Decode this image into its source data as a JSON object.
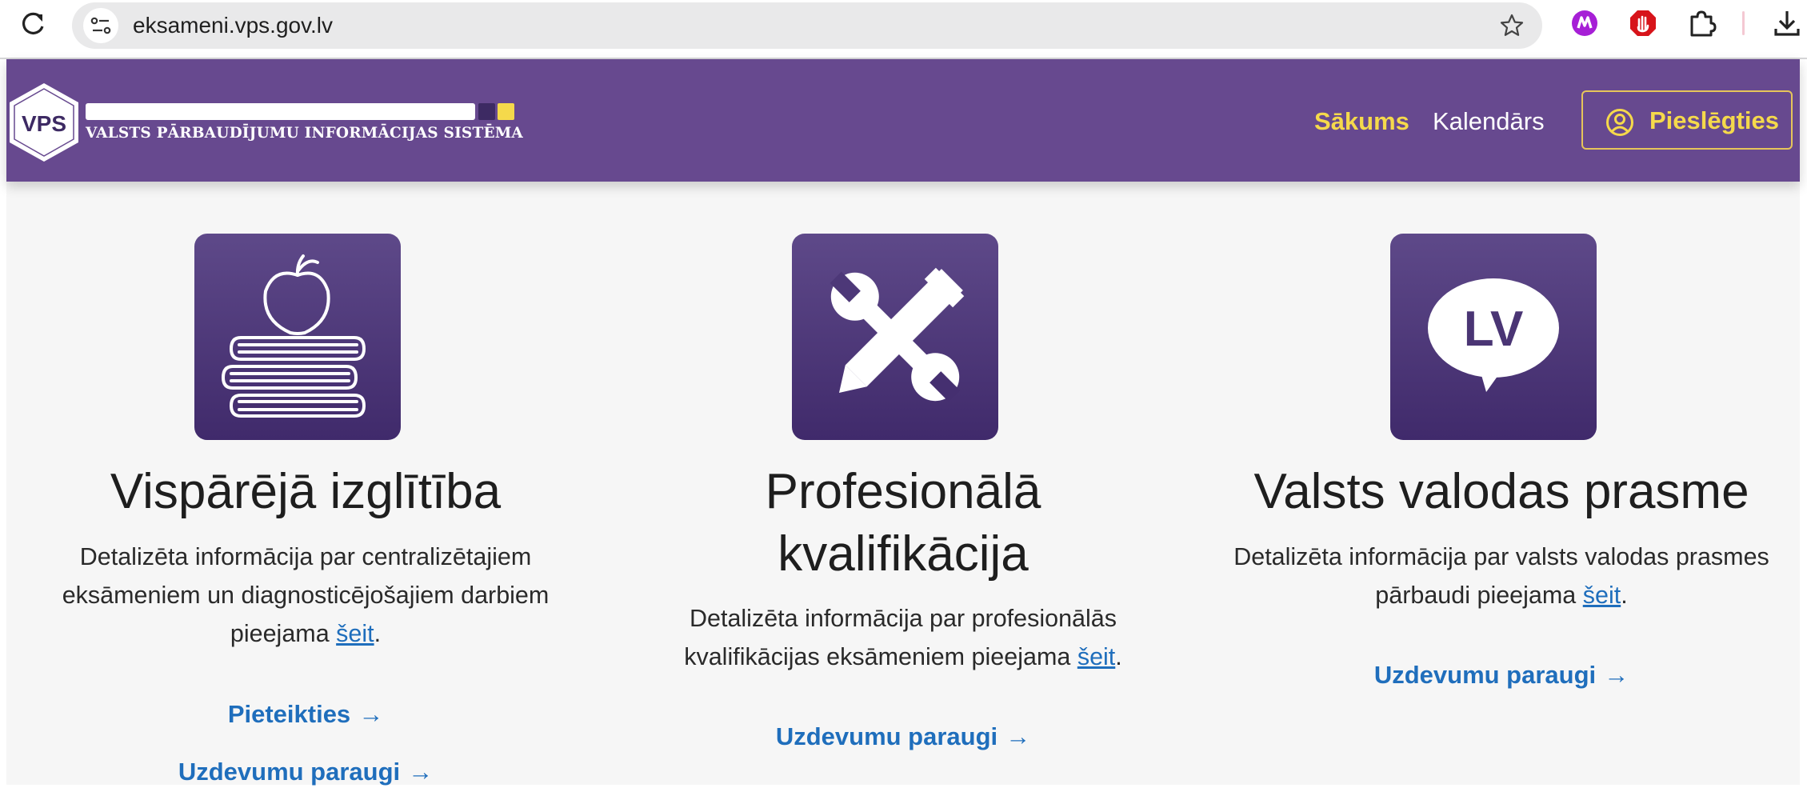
{
  "browser": {
    "url": "eksameni.vps.gov.lv",
    "extensions": [
      "marker-extension-icon",
      "ad-blocker-icon",
      "puzzle-extensions-icon",
      "download-icon"
    ]
  },
  "header": {
    "logo_text": "VPS",
    "system_name": "VALSTS PĀRBAUDĪJUMU INFORMĀCIJAS SISTĒMA",
    "nav": {
      "home": "Sākums",
      "calendar": "Kalendārs"
    },
    "login_label": "Pieslēgties",
    "colors": {
      "header_bg": "#67498f",
      "accent": "#f5d94b",
      "link": "#1f6ebc"
    }
  },
  "cards": [
    {
      "icon": "apple-books-icon",
      "title": "Vispārējā izglītība",
      "desc_lines": [
        "Detalizēta informācija par centralizētajiem",
        "eksāmeniem un diagnosticējošajiem darbiem"
      ],
      "desc_last": "pieejama ",
      "link_text": "šeit",
      "desc_end": ".",
      "actions": [
        "Pieteikties",
        "Uzdevumu paraugi"
      ]
    },
    {
      "icon": "wrench-pencil-icon",
      "title_lines": [
        "Profesionālā",
        "kvalifikācija"
      ],
      "desc_lines": [
        "Detalizēta informācija par profesionālās"
      ],
      "desc_last": "kvalifikācijas eksāmeniem pieejama ",
      "link_text": "šeit",
      "desc_end": ".",
      "actions": [
        "Uzdevumu paraugi"
      ]
    },
    {
      "icon": "lv-speech-bubble-icon",
      "icon_text": "LV",
      "title": "Valsts valodas prasme",
      "desc_lines": [
        "Detalizēta informācija par valsts valodas prasmes"
      ],
      "desc_last": "pārbaudi pieejama ",
      "link_text": "šeit",
      "desc_end": ".",
      "actions": [
        "Uzdevumu paraugi"
      ]
    }
  ],
  "arrow": "→"
}
